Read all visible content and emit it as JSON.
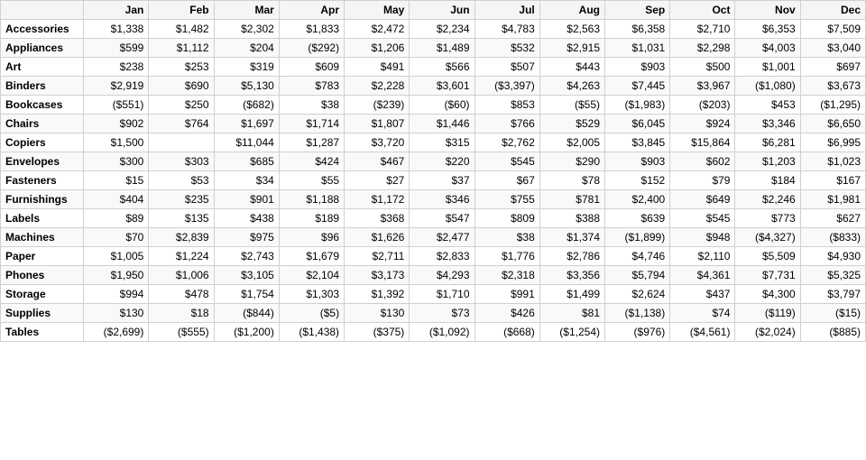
{
  "table": {
    "columns": [
      "",
      "Jan",
      "Feb",
      "Mar",
      "Apr",
      "May",
      "Jun",
      "Jul",
      "Aug",
      "Sep",
      "Oct",
      "Nov",
      "Dec"
    ],
    "rows": [
      {
        "category": "Accessories",
        "values": [
          "$1,338",
          "$1,482",
          "$2,302",
          "$1,833",
          "$2,472",
          "$2,234",
          "$4,783",
          "$2,563",
          "$6,358",
          "$2,710",
          "$6,353",
          "$7,509"
        ]
      },
      {
        "category": "Appliances",
        "values": [
          "$599",
          "$1,112",
          "$204",
          "($292)",
          "$1,206",
          "$1,489",
          "$532",
          "$2,915",
          "$1,031",
          "$2,298",
          "$4,003",
          "$3,040"
        ]
      },
      {
        "category": "Art",
        "values": [
          "$238",
          "$253",
          "$319",
          "$609",
          "$491",
          "$566",
          "$507",
          "$443",
          "$903",
          "$500",
          "$1,001",
          "$697"
        ]
      },
      {
        "category": "Binders",
        "values": [
          "$2,919",
          "$690",
          "$5,130",
          "$783",
          "$2,228",
          "$3,601",
          "($3,397)",
          "$4,263",
          "$7,445",
          "$3,967",
          "($1,080)",
          "$3,673"
        ]
      },
      {
        "category": "Bookcases",
        "values": [
          "($551)",
          "$250",
          "($682)",
          "$38",
          "($239)",
          "($60)",
          "$853",
          "($55)",
          "($1,983)",
          "($203)",
          "$453",
          "($1,295)"
        ]
      },
      {
        "category": "Chairs",
        "values": [
          "$902",
          "$764",
          "$1,697",
          "$1,714",
          "$1,807",
          "$1,446",
          "$766",
          "$529",
          "$6,045",
          "$924",
          "$3,346",
          "$6,650"
        ]
      },
      {
        "category": "Copiers",
        "values": [
          "$1,500",
          "",
          "$11,044",
          "$1,287",
          "$3,720",
          "$315",
          "$2,762",
          "$2,005",
          "$3,845",
          "$15,864",
          "$6,281",
          "$6,995"
        ]
      },
      {
        "category": "Envelopes",
        "values": [
          "$300",
          "$303",
          "$685",
          "$424",
          "$467",
          "$220",
          "$545",
          "$290",
          "$903",
          "$602",
          "$1,203",
          "$1,023"
        ]
      },
      {
        "category": "Fasteners",
        "values": [
          "$15",
          "$53",
          "$34",
          "$55",
          "$27",
          "$37",
          "$67",
          "$78",
          "$152",
          "$79",
          "$184",
          "$167"
        ]
      },
      {
        "category": "Furnishings",
        "values": [
          "$404",
          "$235",
          "$901",
          "$1,188",
          "$1,172",
          "$346",
          "$755",
          "$781",
          "$2,400",
          "$649",
          "$2,246",
          "$1,981"
        ]
      },
      {
        "category": "Labels",
        "values": [
          "$89",
          "$135",
          "$438",
          "$189",
          "$368",
          "$547",
          "$809",
          "$388",
          "$639",
          "$545",
          "$773",
          "$627"
        ]
      },
      {
        "category": "Machines",
        "values": [
          "$70",
          "$2,839",
          "$975",
          "$96",
          "$1,626",
          "$2,477",
          "$38",
          "$1,374",
          "($1,899)",
          "$948",
          "($4,327)",
          "($833)"
        ]
      },
      {
        "category": "Paper",
        "values": [
          "$1,005",
          "$1,224",
          "$2,743",
          "$1,679",
          "$2,711",
          "$2,833",
          "$1,776",
          "$2,786",
          "$4,746",
          "$2,110",
          "$5,509",
          "$4,930"
        ]
      },
      {
        "category": "Phones",
        "values": [
          "$1,950",
          "$1,006",
          "$3,105",
          "$2,104",
          "$3,173",
          "$4,293",
          "$2,318",
          "$3,356",
          "$5,794",
          "$4,361",
          "$7,731",
          "$5,325"
        ]
      },
      {
        "category": "Storage",
        "values": [
          "$994",
          "$478",
          "$1,754",
          "$1,303",
          "$1,392",
          "$1,710",
          "$991",
          "$1,499",
          "$2,624",
          "$437",
          "$4,300",
          "$3,797"
        ]
      },
      {
        "category": "Supplies",
        "values": [
          "$130",
          "$18",
          "($844)",
          "($5)",
          "$130",
          "$73",
          "$426",
          "$81",
          "($1,138)",
          "$74",
          "($119)",
          "($15)"
        ]
      },
      {
        "category": "Tables",
        "values": [
          "($2,699)",
          "($555)",
          "($1,200)",
          "($1,438)",
          "($375)",
          "($1,092)",
          "($668)",
          "($1,254)",
          "($976)",
          "($4,561)",
          "($2,024)",
          "($885)"
        ]
      }
    ]
  }
}
